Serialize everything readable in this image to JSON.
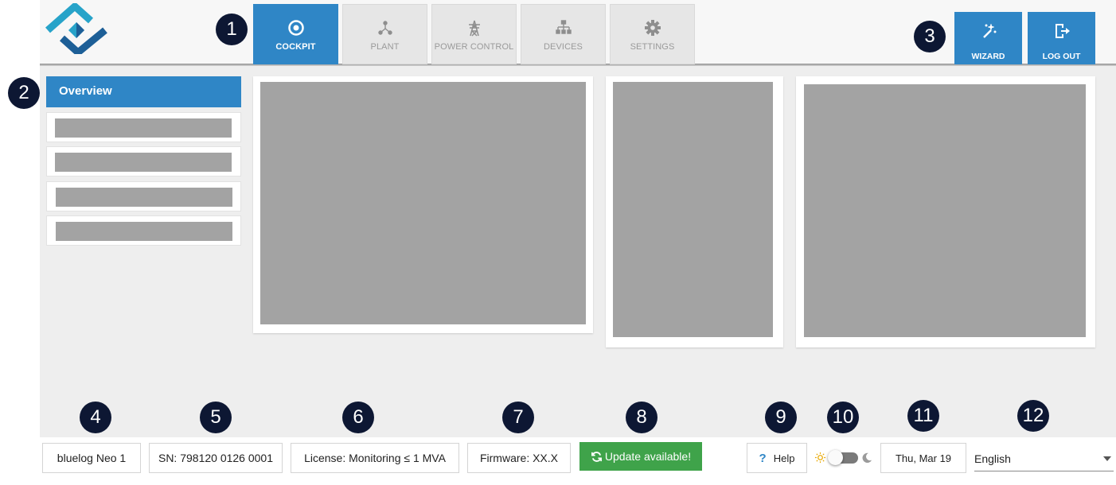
{
  "header": {
    "tabs": [
      {
        "label": "COCKPIT",
        "icon": "cockpit-target-icon",
        "active": true
      },
      {
        "label": "PLANT",
        "icon": "plant-nodes-icon",
        "active": false
      },
      {
        "label": "POWER CONTROL",
        "icon": "power-pylon-icon",
        "active": false
      },
      {
        "label": "DEVICES",
        "icon": "devices-hierarchy-icon",
        "active": false
      },
      {
        "label": "SETTINGS",
        "icon": "gear-icon",
        "active": false
      }
    ],
    "wizard_label": "WIZARD",
    "logout_label": "LOG OUT"
  },
  "sidebar": {
    "active_item": "Overview"
  },
  "footer": {
    "device_name": "bluelog Neo 1",
    "serial": "SN: 798120 0126 0001",
    "license": "License: Monitoring ≤ 1 MVA",
    "firmware": "Firmware: XX.X",
    "update_label": "Update available!",
    "help_icon": "?",
    "help_label": "Help",
    "date": "Thu, Mar 19",
    "language": "English"
  },
  "markers": [
    "1",
    "2",
    "3",
    "4",
    "5",
    "6",
    "7",
    "8",
    "9",
    "10",
    "11",
    "12"
  ],
  "colors": {
    "accent": "#2f86c6",
    "update_green": "#3fa34a",
    "marker_bg": "#0d1733",
    "placeholder": "#a3a3a3"
  }
}
